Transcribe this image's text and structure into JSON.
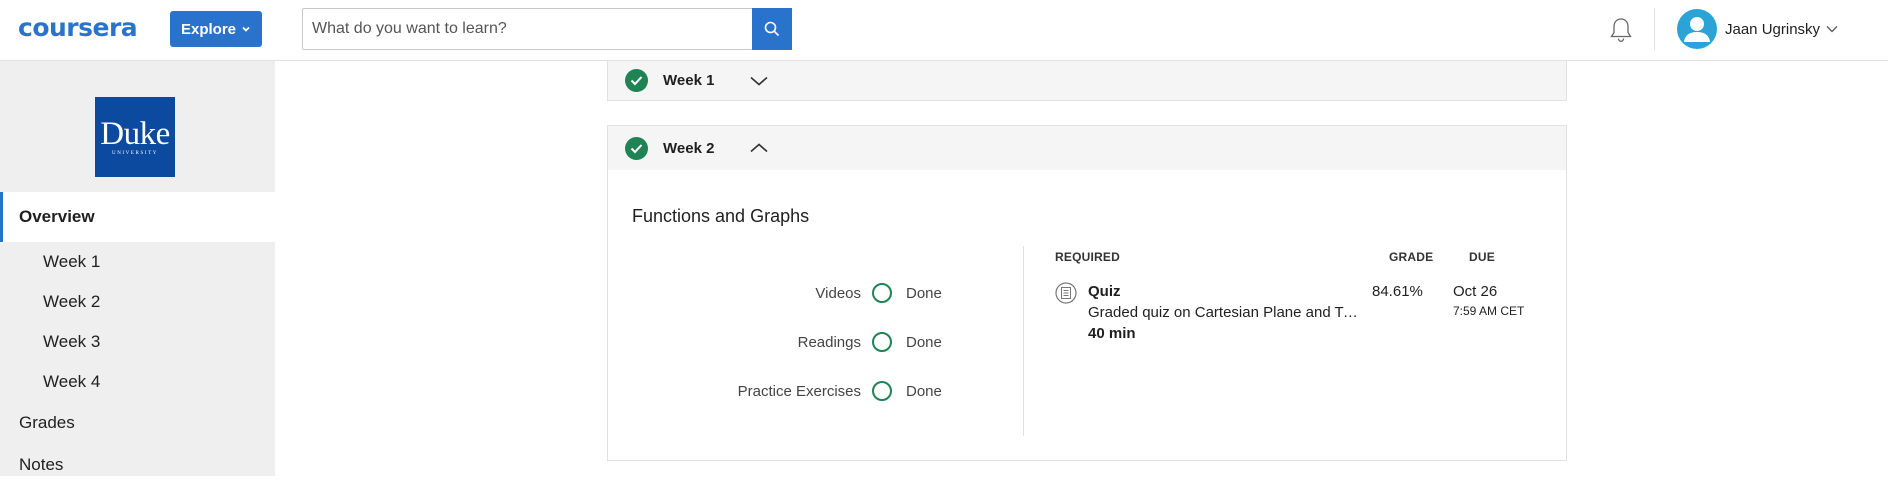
{
  "header": {
    "logo_text": "coursera",
    "explore_label": "Explore",
    "search_placeholder": "What do you want to learn?",
    "user_name": "Jaan Ugrinsky"
  },
  "sidebar": {
    "brand_logo_main": "Duke",
    "brand_logo_sub": "UNIVERSITY",
    "items": [
      {
        "label": "Overview"
      },
      {
        "label": "Week 1"
      },
      {
        "label": "Week 2"
      },
      {
        "label": "Week 3"
      },
      {
        "label": "Week 4"
      },
      {
        "label": "Grades"
      },
      {
        "label": "Notes"
      }
    ]
  },
  "weeks": [
    {
      "title": "Week 1",
      "expanded": false,
      "completed": true
    },
    {
      "title": "Week 2",
      "expanded": true,
      "completed": true
    }
  ],
  "week2": {
    "section_title": "Functions and Graphs",
    "summary": [
      {
        "label": "Videos",
        "status": "Done"
      },
      {
        "label": "Readings",
        "status": "Done"
      },
      {
        "label": "Practice Exercises",
        "status": "Done"
      }
    ],
    "table_headers": {
      "required": "REQUIRED",
      "grade": "GRADE",
      "due": "DUE"
    },
    "item": {
      "type": "Quiz",
      "title": "Graded quiz on Cartesian Plane and Ty...",
      "duration": "40 min",
      "grade": "84.61%",
      "due_date": "Oct 26",
      "due_time": "7:59 AM CET"
    }
  },
  "colors": {
    "brand_blue": "#2a73cc",
    "complete_green": "#1f8354",
    "duke_blue": "#0b4a9e",
    "sidebar_bg": "#efefef"
  }
}
